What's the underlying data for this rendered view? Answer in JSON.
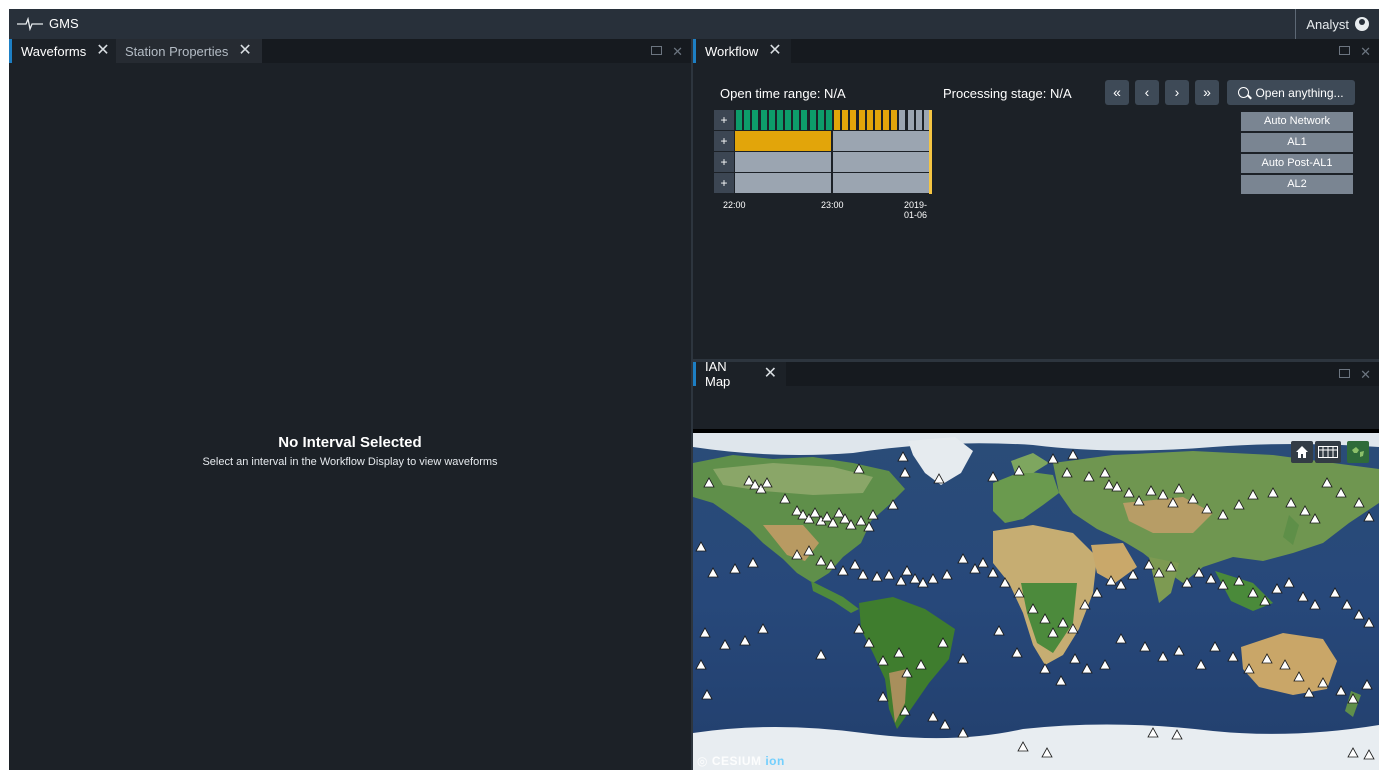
{
  "app": {
    "name": "GMS",
    "user": "Analyst"
  },
  "left_panel": {
    "tabs": [
      {
        "label": "Waveforms"
      },
      {
        "label": "Station Properties"
      }
    ],
    "empty_title": "No Interval Selected",
    "empty_message": "Select an interval in the Workflow Display to view waveforms"
  },
  "workflow": {
    "tab_label": "Workflow",
    "open_time_range": "Open time range: N/A",
    "processing_stage": "Processing stage: N/A",
    "nav": [
      "«",
      "‹",
      "›",
      "»"
    ],
    "open_anything": "Open anything...",
    "stages": [
      "Auto Network",
      "AL1",
      "Auto Post-AL1",
      "AL2"
    ],
    "time_labels": [
      "22:00",
      "23:00",
      "2019-01-06"
    ],
    "row_status": [
      {
        "first_hour": "complete",
        "second_hour": "in-progress"
      },
      {
        "first_hour": "in-progress",
        "second_hour": "not-started"
      },
      {
        "first_hour": "not-started",
        "second_hour": "not-started"
      },
      {
        "first_hour": "not-started",
        "second_hour": "not-started"
      }
    ],
    "colors": {
      "complete": "#0d9c6a",
      "in_progress": "#e2a50a",
      "not_started": "#9ba5b1",
      "now_marker": "#f5c542"
    }
  },
  "map": {
    "tab_label": "IAN Map",
    "controls": [
      "home-icon",
      "layers-grid-icon",
      "globe-icon"
    ],
    "attribution": "CESIUM",
    "attribution_suffix": "ion"
  }
}
